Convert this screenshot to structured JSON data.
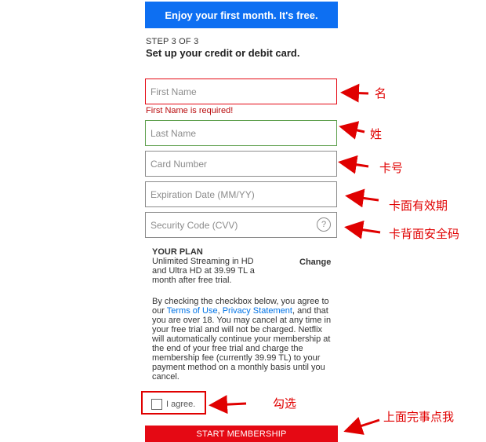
{
  "banner": {
    "text": "Enjoy your first month. It's free."
  },
  "step": {
    "label": "STEP 3 OF 3",
    "title": "Set up your credit or debit card."
  },
  "form": {
    "first_name": {
      "placeholder": "First Name",
      "error": "First Name is required!",
      "state": "error"
    },
    "last_name": {
      "placeholder": "Last Name",
      "state": "valid"
    },
    "card_number": {
      "placeholder": "Card Number"
    },
    "expiration": {
      "placeholder": "Expiration Date (MM/YY)"
    },
    "security_code": {
      "placeholder": "Security Code (CVV)",
      "help": "?"
    }
  },
  "plan": {
    "title": "YOUR PLAN",
    "description": "Unlimited Streaming in HD and Ultra HD at 39.99 TL a month after free trial.",
    "change_label": "Change"
  },
  "terms": {
    "before": "By checking the checkbox below, you agree to our ",
    "terms_link": "Terms of Use",
    "sep": ", ",
    "privacy_link": "Privacy Statement",
    "after": ", and that you are over 18. You may cancel at any time in your free trial and will not be charged. Netflix will automatically continue your membership at the end of your free trial and charge the membership fee (currently 39.99 TL) to your payment method on a monthly basis until you cancel."
  },
  "agree": {
    "label": "I agree.",
    "checked": false
  },
  "start_button": {
    "label": "START MEMBERSHIP"
  },
  "annotations": {
    "first_name": "名",
    "last_name": "姓",
    "card_number": "卡号",
    "expiration": "卡面有效期",
    "security_code": "卡背面安全码",
    "agree": "勾选",
    "submit": "上面完事点我"
  },
  "colors": {
    "banner": "#0d6ff2",
    "start_button": "#e50914",
    "error": "#e50914",
    "valid": "#5fa04e",
    "link": "#0073e6",
    "annotation": "#e00000"
  }
}
